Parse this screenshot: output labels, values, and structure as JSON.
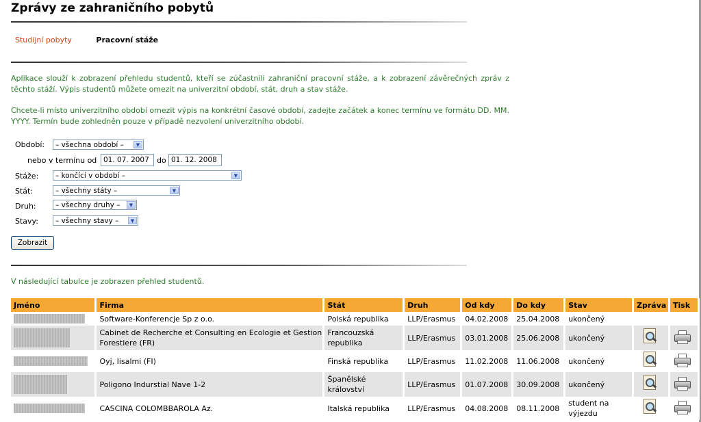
{
  "page": {
    "title": "Zprávy ze zahraničního pobytů"
  },
  "tabs": {
    "first": "Studijní pobyty",
    "second": "Pracovní stáže"
  },
  "intro": {
    "p1": "Aplikace slouží k zobrazení přehledu studentů, kteří se zúčastnili zahraniční pracovní stáže, a k zobrazení závěrečných zpráv z těchto stáží. Výpis studentů můžete omezit na univerzitní období, stát, druh a stav stáže.",
    "p2": "Chcete-li místo univerzitního období omezit výpis na konkrétní časové období, zadejte začátek a konec termínu ve formátu DD. MM. YYYY. Termín bude zohledněn pouze v případě nezvolení univerzitního období."
  },
  "form": {
    "obdobi_label": "Období:",
    "obdobi_value": "– všechna období –",
    "termin_label": "nebo v termínu od",
    "od_value": "01. 07. 2007",
    "do_label": "do",
    "do_value": "01. 12. 2008",
    "staze_label": "Stáže:",
    "staze_value": "– končící v období –",
    "stat_label": "Stát:",
    "stat_value": "– všechny státy –",
    "druh_label": "Druh:",
    "druh_value": "– všechny druhy –",
    "stavy_label": "Stavy:",
    "stavy_value": "– všechny stavy –",
    "submit": "Zobrazit"
  },
  "table_note": "V následující tabulce je zobrazen přehled studentů.",
  "table": {
    "headers": [
      "Jméno",
      "Firma",
      "Stát",
      "Druh",
      "Od kdy",
      "Do kdy",
      "Stav",
      "Zpráva",
      "Tisk"
    ],
    "rows": [
      {
        "firma": "Software-Konferencje Sp z o.o.",
        "stat": "Polská republika",
        "druh": "LLP/Erasmus",
        "od": "04.02.2008",
        "do": "25.04.2008",
        "stav": "ukončený"
      },
      {
        "firma": "Cabinet de Recherche et Consulting en Ecologie et Gestion Forestiere (FR)",
        "stat": "Francouzská republika",
        "druh": "LLP/Erasmus",
        "od": "03.01.2008",
        "do": "25.06.2008",
        "stav": "ukončený"
      },
      {
        "firma": "Oyj, Iisalmi (FI)",
        "stat": "Finská republika",
        "druh": "LLP/Erasmus",
        "od": "11.02.2008",
        "do": "11.06.2008",
        "stav": "ukončený"
      },
      {
        "firma": "Poligono Indurstial Nave 1-2",
        "stat": "Španělské království",
        "druh": "LLP/Erasmus",
        "od": "01.07.2008",
        "do": "30.09.2008",
        "stav": "ukončený"
      },
      {
        "firma": "CASCINA COLOMBBAROLA Az.",
        "stat": "Italská republika",
        "druh": "LLP/Erasmus",
        "od": "04.08.2008",
        "do": "08.11.2008",
        "stav": "student na výjezdu"
      }
    ]
  }
}
